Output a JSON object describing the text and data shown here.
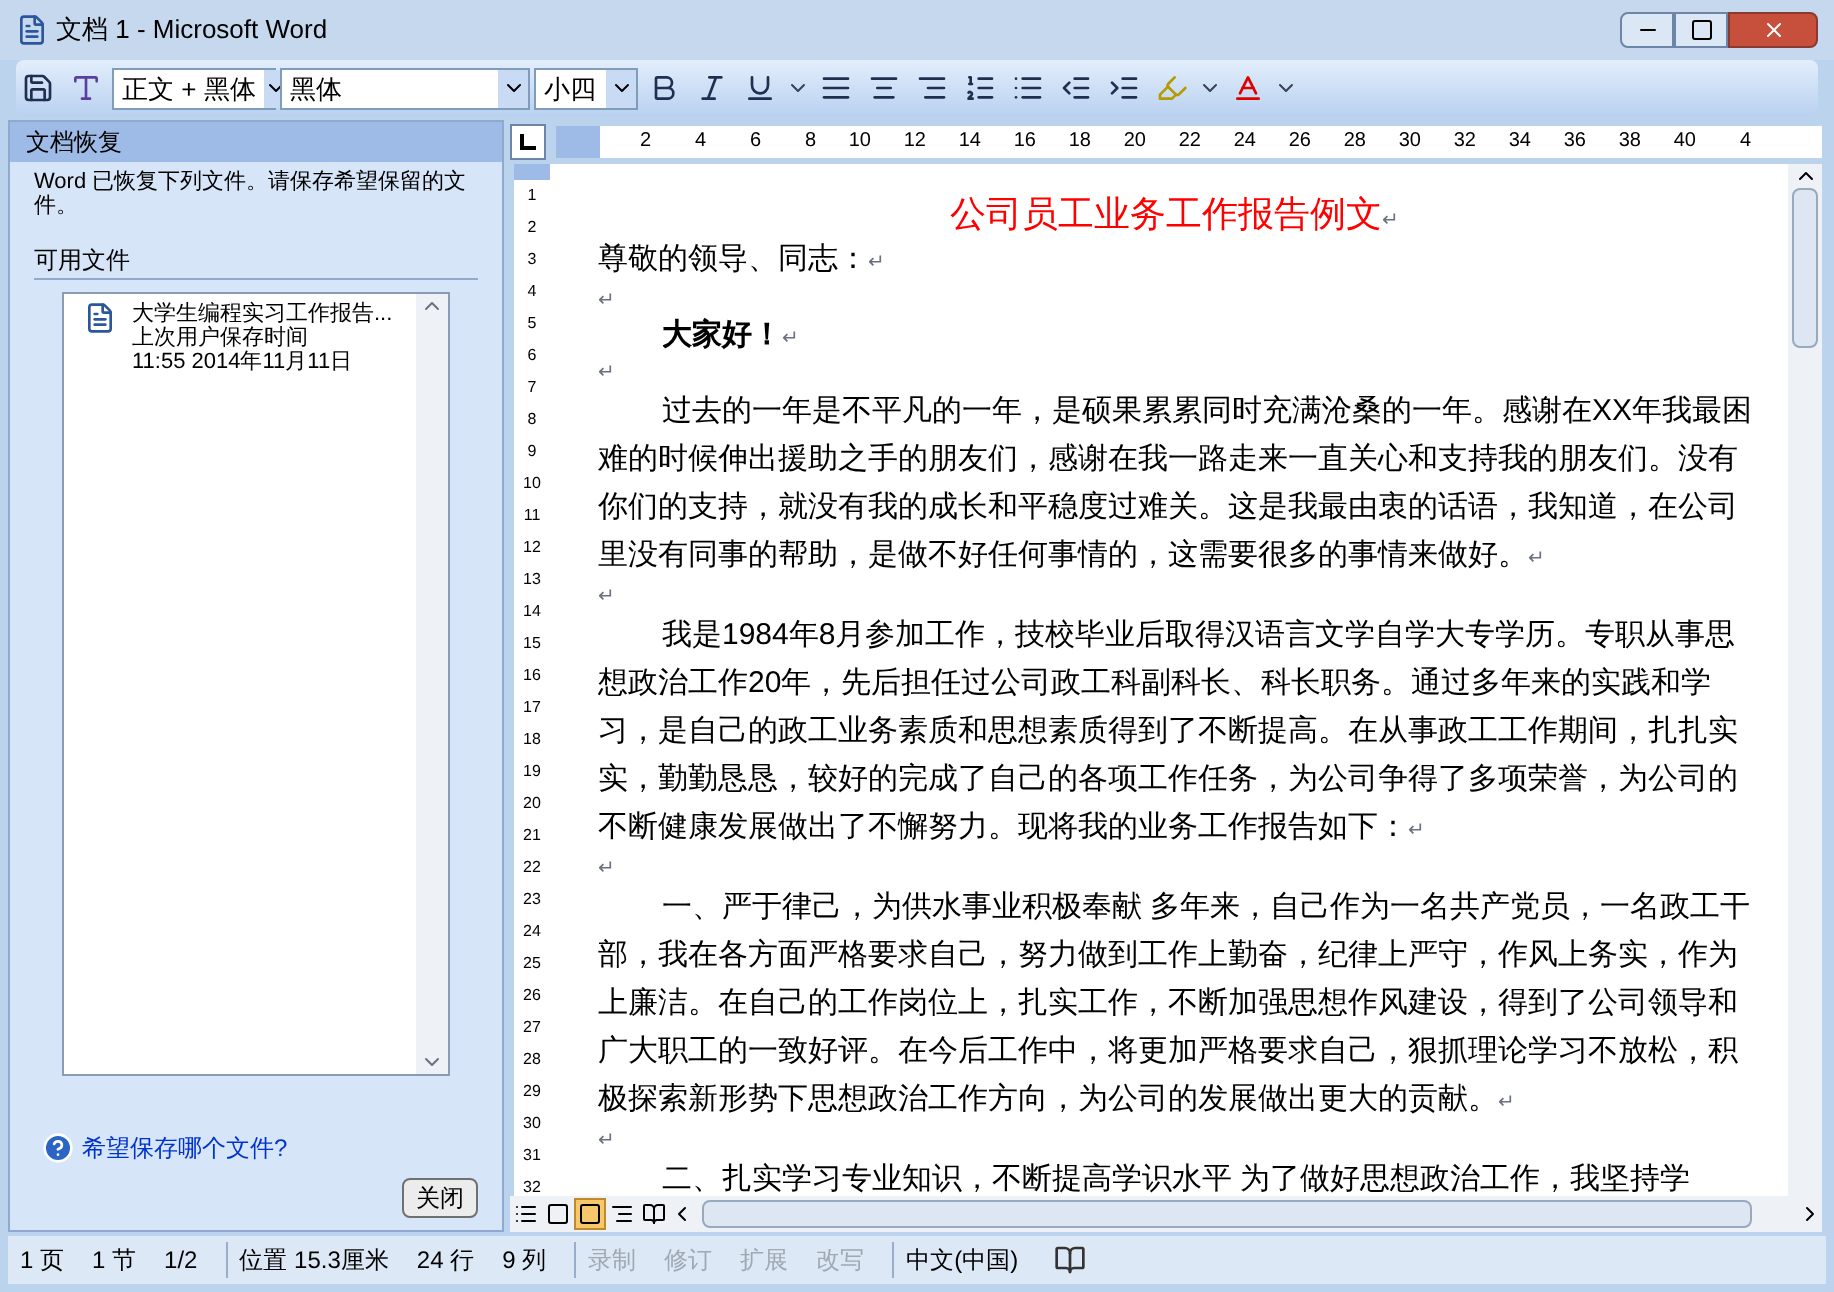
{
  "window": {
    "title": "文档 1 - Microsoft Word"
  },
  "toolbar": {
    "style": "正文 + 黑体",
    "font": "黑体",
    "size": "小四"
  },
  "recovery_pane": {
    "title": "文档恢复",
    "message": "Word 已恢复下列文件。请保存希望保留的文件。",
    "section": "可用文件",
    "files": [
      {
        "name": "大学生编程实习工作报告...",
        "detail": "上次用户保存时间",
        "time": "11:55 2014年11月11日"
      }
    ],
    "help_link": "希望保存哪个文件?",
    "close_button": "关闭"
  },
  "ruler": {
    "ticks": [
      "2",
      "4",
      "6",
      "8",
      "10",
      "12",
      "14",
      "16",
      "18",
      "20",
      "22",
      "24",
      "26",
      "28",
      "30",
      "32",
      "34",
      "36",
      "38",
      "40",
      "4"
    ],
    "vertical_ticks": [
      "1",
      "2",
      "3",
      "4",
      "5",
      "6",
      "7",
      "8",
      "9",
      "10",
      "11",
      "12",
      "13",
      "14",
      "15",
      "16",
      "17",
      "18",
      "19",
      "20",
      "21",
      "22",
      "23",
      "24",
      "25",
      "26",
      "27",
      "28",
      "29",
      "30",
      "31",
      "32"
    ]
  },
  "document": {
    "paragraphs": [
      {
        "kind": "title",
        "text": "公司员工业务工作报告例文",
        "mark": "↵"
      },
      {
        "kind": "plain",
        "text": "尊敬的领导、同志：",
        "mark": "↵"
      },
      {
        "kind": "plain",
        "mark": "↵"
      },
      {
        "kind": "bold",
        "text": "大家好！",
        "mark": "↵"
      },
      {
        "kind": "plain",
        "mark": "↵"
      },
      {
        "kind": "body",
        "text": "过去的一年是不平凡的一年，是硕果累累同时充满沧桑的一年。感谢在XX年我最困难的时候伸出援助之手的朋友们，感谢在我一路走来一直关心和支持我的朋友们。没有你们的支持，就没有我的成长和平稳度过难关。这是我最由衷的话语，我知道，在公司里没有同事的帮助，是做不好任何事情的，这需要很多的事情来做好。",
        "mark": "↵"
      },
      {
        "kind": "plain",
        "mark": "↵"
      },
      {
        "kind": "body",
        "text": "我是1984年8月参加工作，技校毕业后取得汉语言文学自学大专学历。专职从事思想政治工作20年，先后担任过公司政工科副科长、科长职务。通过多年来的实践和学习，是自己的政工业务素质和思想素质得到了不断提高。在从事政工工作期间，扎扎实实，勤勤恳恳，较好的完成了自己的各项工作任务，为公司争得了多项荣誉，为公司的不断健康发展做出了不懈努力。现将我的业务工作报告如下：",
        "mark": "↵"
      },
      {
        "kind": "plain",
        "mark": "↵"
      },
      {
        "kind": "body",
        "text": "一、严于律己，为供水事业积极奉献 多年来，自己作为一名共产党员，一名政工干部，我在各方面严格要求自己，努力做到工作上勤奋，纪律上严守，作风上务实，作为上廉洁。在自己的工作岗位上，扎实工作，不断加强思想作风建设，得到了公司领导和广大职工的一致好评。在今后工作中，将更加严格要求自己，狠抓理论学习不放松，积极探索新形势下思想政治工作方向，为公司的发展做出更大的贡献。",
        "mark": "↵"
      },
      {
        "kind": "plain",
        "mark": "↵"
      },
      {
        "kind": "body",
        "text": "二、扎实学习专业知识，不断提高学识水平 为了做好思想政治工作，我坚持学"
      }
    ]
  },
  "status_bar": [
    {
      "text": "1 页",
      "disabled": false
    },
    {
      "text": "1 节",
      "disabled": false
    },
    {
      "text": "1/2",
      "disabled": false
    },
    {
      "text": "位置 15.3厘米",
      "disabled": false
    },
    {
      "text": "24 行",
      "disabled": false
    },
    {
      "text": "9 列",
      "disabled": false
    },
    {
      "text": "录制",
      "disabled": true
    },
    {
      "text": "修订",
      "disabled": true
    },
    {
      "text": "扩展",
      "disabled": true
    },
    {
      "text": "改写",
      "disabled": true
    },
    {
      "text": "中文(中国)",
      "disabled": false
    }
  ]
}
